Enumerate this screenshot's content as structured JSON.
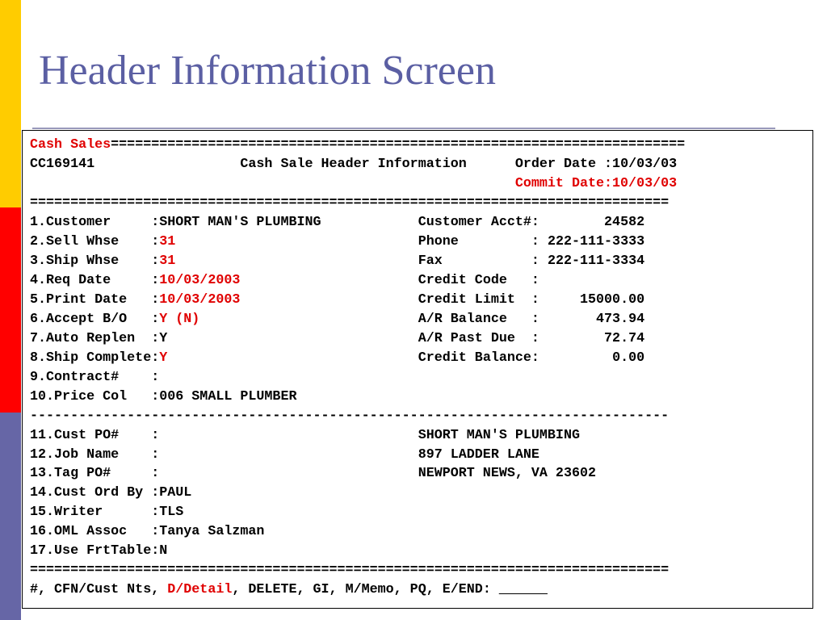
{
  "colors": {
    "title": "#5B5FA3",
    "highlight": "#E00000",
    "bar_yellow": "#FFCC00",
    "bar_red": "#FF0000",
    "bar_purple": "#6666A6"
  },
  "title": "Header Information Screen",
  "screen": {
    "mode": "Cash Sales",
    "mode_rule": "=======================================================================",
    "rule": "===============================================================================",
    "dash_rule": "-------------------------------------------------------------------------------",
    "order_no": "CC169141",
    "header_title": "Cash Sale Header Information",
    "order_date": "Order Date :10/03/03",
    "commit_date": "Commit Date:10/03/03",
    "fields": [
      {
        "label": "1.Customer     :",
        "value": "SHORT MAN'S PLUMBING"
      },
      {
        "label": "2.Sell Whse    :",
        "value": "31"
      },
      {
        "label": "3.Ship Whse    :",
        "value": "31"
      },
      {
        "label": "4.Req Date     :",
        "value": "10/03/2003"
      },
      {
        "label": "5.Print Date   :",
        "value": "10/03/2003"
      },
      {
        "label": "6.Accept B/O   :",
        "value": "Y (N)"
      },
      {
        "label": "7.Auto Replen  :",
        "value": "Y"
      },
      {
        "label": "8.Ship Complete:",
        "value": "Y"
      },
      {
        "label": "9.Contract#    :",
        "value": ""
      },
      {
        "label": "10.Price Col   :",
        "value": "006 SMALL PLUMBER"
      },
      {
        "label": "11.Cust PO#    :",
        "value": ""
      },
      {
        "label": "12.Job Name    :",
        "value": ""
      },
      {
        "label": "13.Tag PO#     :",
        "value": ""
      },
      {
        "label": "14.Cust Ord By :",
        "value": "PAUL"
      },
      {
        "label": "15.Writer      :",
        "value": "TLS"
      },
      {
        "label": "16.OML Assoc   :",
        "value": "Tanya Salzman"
      },
      {
        "label": "17.Use FrtTable:",
        "value": "N"
      }
    ],
    "credit": [
      {
        "label": "Customer Acct#:",
        "value": "24582"
      },
      {
        "label": "Phone         :",
        "value": "222-111-3333"
      },
      {
        "label": "Fax           :",
        "value": "222-111-3334"
      },
      {
        "label": "Credit Code   :",
        "value": ""
      },
      {
        "label": "Credit Limit  :",
        "value": "15000.00"
      },
      {
        "label": "A/R Balance   :",
        "value": "473.94"
      },
      {
        "label": "A/R Past Due  :",
        "value": "72.74"
      },
      {
        "label": "Credit Balance:",
        "value": "0.00"
      }
    ],
    "address": [
      "SHORT MAN'S PLUMBING",
      "897 LADDER LANE",
      "NEWPORT NEWS, VA 23602"
    ],
    "commands": {
      "part1": "#, CFN/Cust Nts, ",
      "detail": "D/Detail",
      "part2": ", DELETE, GI, M/Memo, PQ, E/END: ",
      "input": "______"
    }
  }
}
